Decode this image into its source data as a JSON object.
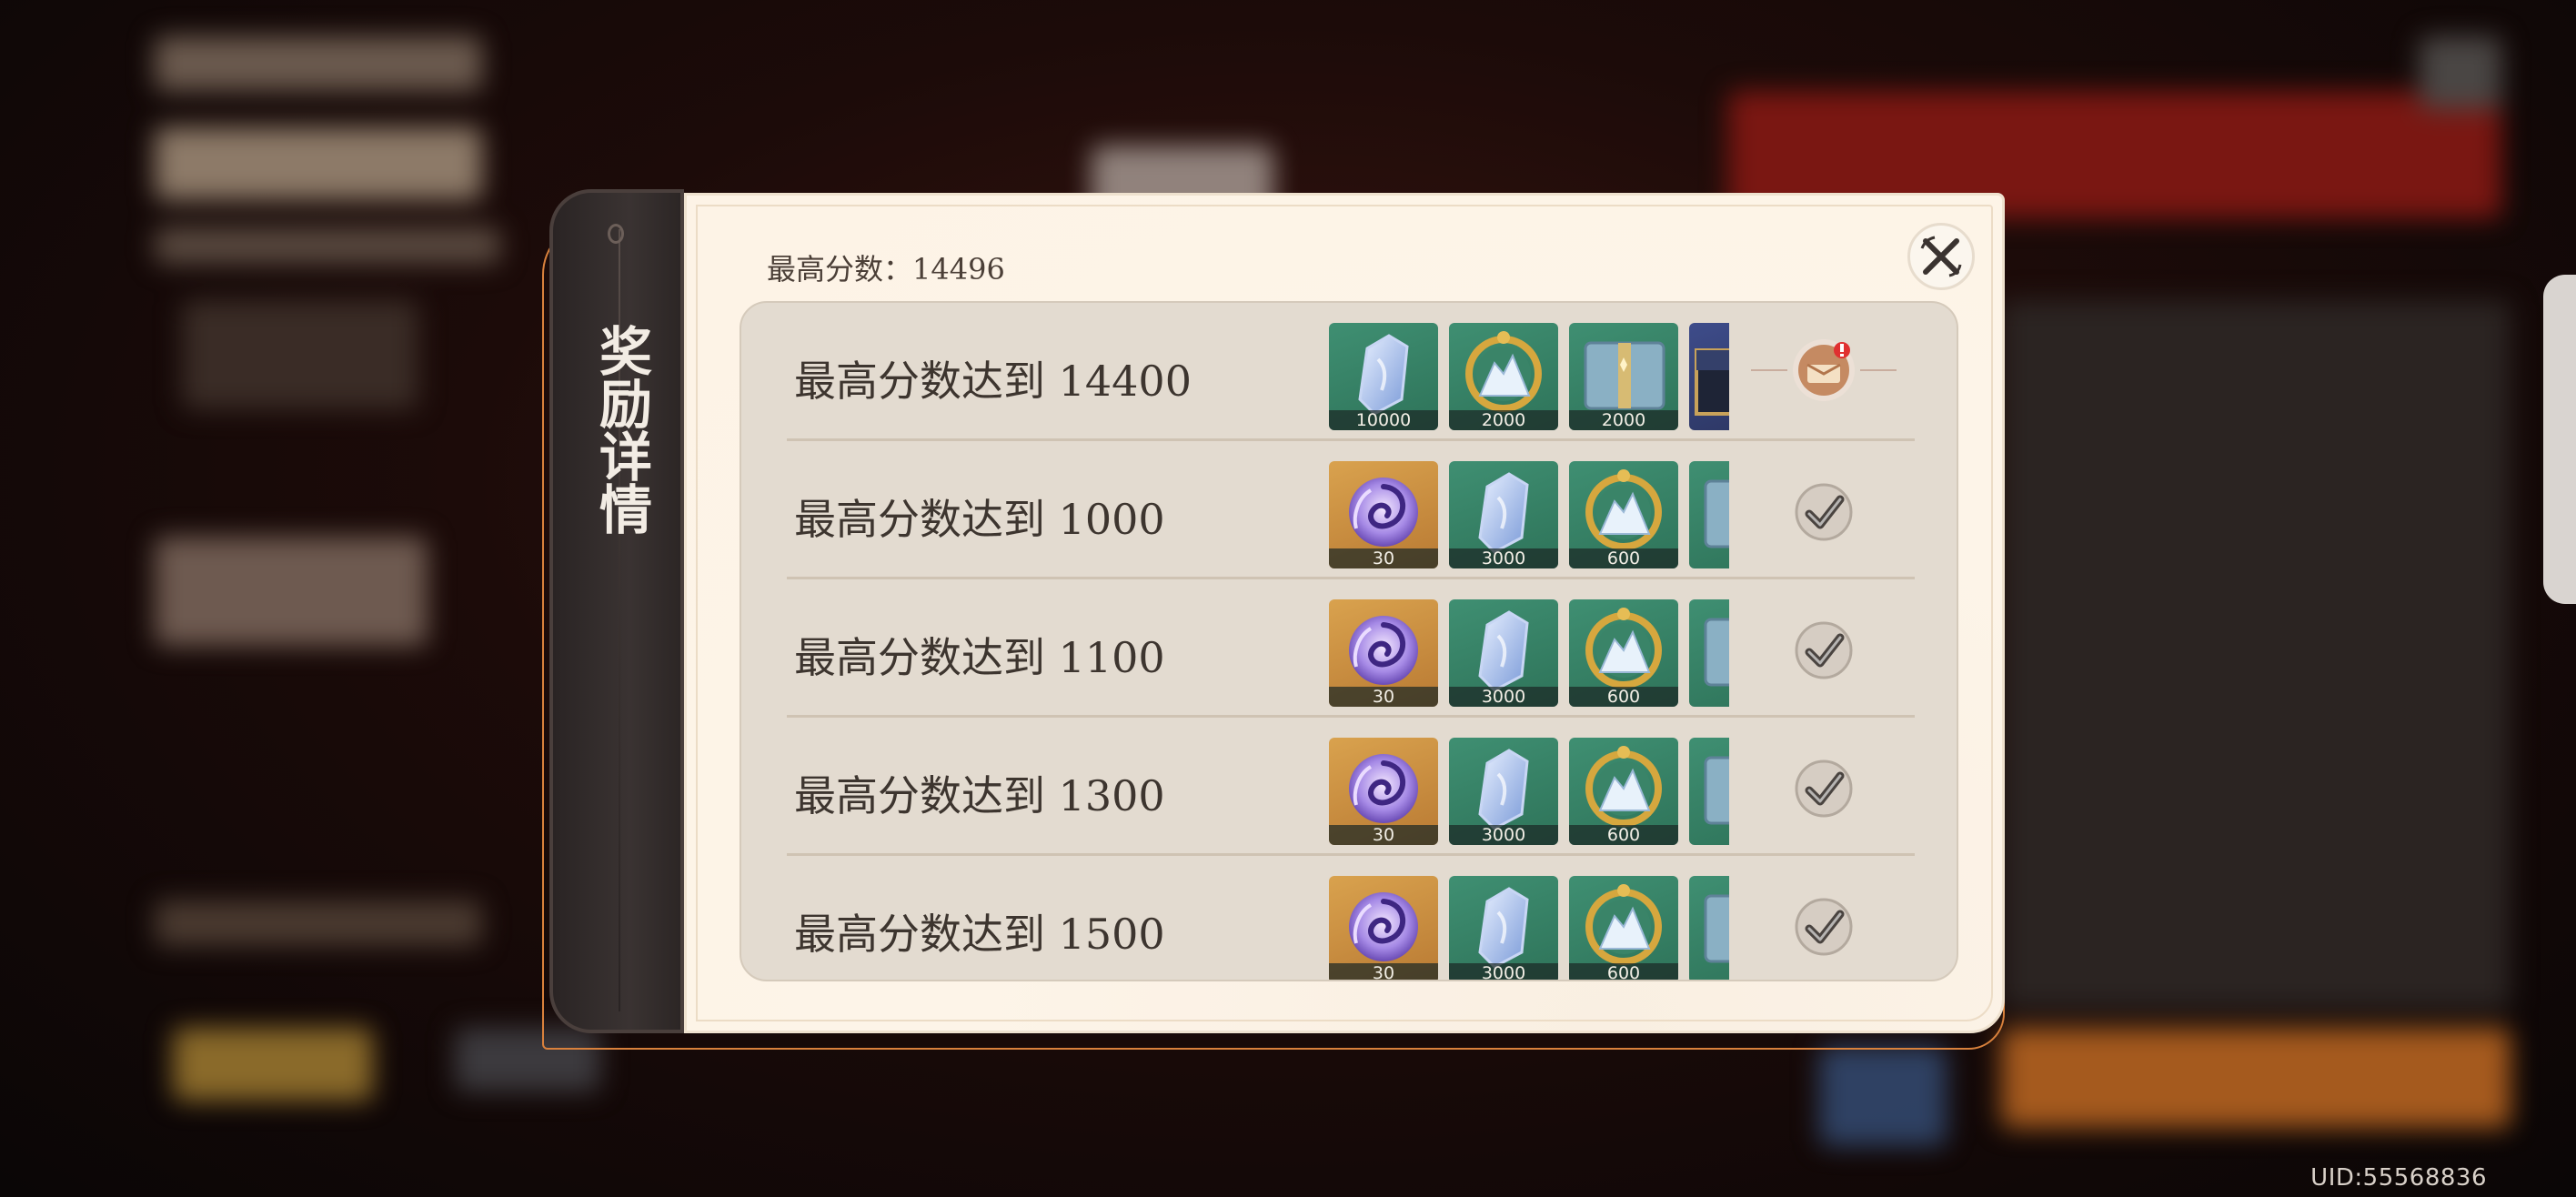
{
  "modal": {
    "tab_title": "奖励详情",
    "best_score": "最高分数：14496"
  },
  "rewards": [
    {
      "label": "最高分数达到 14400",
      "status": "claimable",
      "items": [
        {
          "icon": "crystal-icon",
          "count": "10000",
          "bg": "green"
        },
        {
          "icon": "ring-ore-icon",
          "count": "2000",
          "bg": "green"
        },
        {
          "icon": "book-icon",
          "count": "2000",
          "bg": "green"
        },
        {
          "icon": "chest-icon",
          "count": "",
          "bg": "blue"
        }
      ]
    },
    {
      "label": "最高分数达到 1000",
      "status": "claimed",
      "items": [
        {
          "icon": "swirl-gem-icon",
          "count": "30",
          "bg": "gold"
        },
        {
          "icon": "crystal-icon",
          "count": "3000",
          "bg": "green"
        },
        {
          "icon": "ring-ore-icon",
          "count": "600",
          "bg": "green"
        },
        {
          "icon": "book-icon",
          "count": "",
          "bg": "green"
        }
      ]
    },
    {
      "label": "最高分数达到 1100",
      "status": "claimed",
      "items": [
        {
          "icon": "swirl-gem-icon",
          "count": "30",
          "bg": "gold"
        },
        {
          "icon": "crystal-icon",
          "count": "3000",
          "bg": "green"
        },
        {
          "icon": "ring-ore-icon",
          "count": "600",
          "bg": "green"
        },
        {
          "icon": "book-icon",
          "count": "",
          "bg": "green"
        }
      ]
    },
    {
      "label": "最高分数达到 1300",
      "status": "claimed",
      "items": [
        {
          "icon": "swirl-gem-icon",
          "count": "30",
          "bg": "gold"
        },
        {
          "icon": "crystal-icon",
          "count": "3000",
          "bg": "green"
        },
        {
          "icon": "ring-ore-icon",
          "count": "600",
          "bg": "green"
        },
        {
          "icon": "book-icon",
          "count": "",
          "bg": "green"
        }
      ]
    },
    {
      "label": "最高分数达到 1500",
      "status": "claimed",
      "items": [
        {
          "icon": "swirl-gem-icon",
          "count": "30",
          "bg": "gold"
        },
        {
          "icon": "crystal-icon",
          "count": "3000",
          "bg": "green"
        },
        {
          "icon": "ring-ore-icon",
          "count": "600",
          "bg": "green"
        },
        {
          "icon": "book-icon",
          "count": "",
          "bg": "green"
        }
      ]
    }
  ],
  "footer": {
    "uid": "UID:55568836"
  },
  "colors": {
    "accent_orange": "#d9813c",
    "panel_bg": "#fdf3e6",
    "tab_dark": "#2a2424",
    "item_green": "#3f8f72",
    "item_gold": "#d9a24e"
  }
}
